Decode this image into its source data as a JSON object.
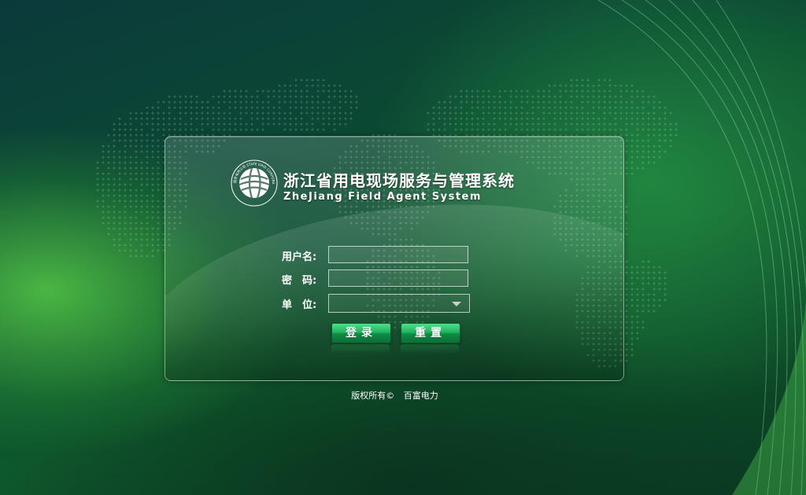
{
  "header": {
    "title_cn": "浙江省用电现场服务与管理系统",
    "title_en": "ZheJiang Field Agent System",
    "logo_icon": "state-grid-logo-icon",
    "logo_text": "国家电网公司 STATE GRID CORPORATION OF CHINA"
  },
  "form": {
    "username_label": "用户名:",
    "username_value": "",
    "password_label": "密　码:",
    "password_value": "",
    "unit_label": "单　位:",
    "unit_selected": ""
  },
  "buttons": {
    "login_label": "登录",
    "reset_label": "重置"
  },
  "footer": {
    "copyright_prefix": "版权所有©",
    "company": "百富电力"
  },
  "colors": {
    "button_green": "#1fb45e",
    "text": "#ffffff"
  }
}
